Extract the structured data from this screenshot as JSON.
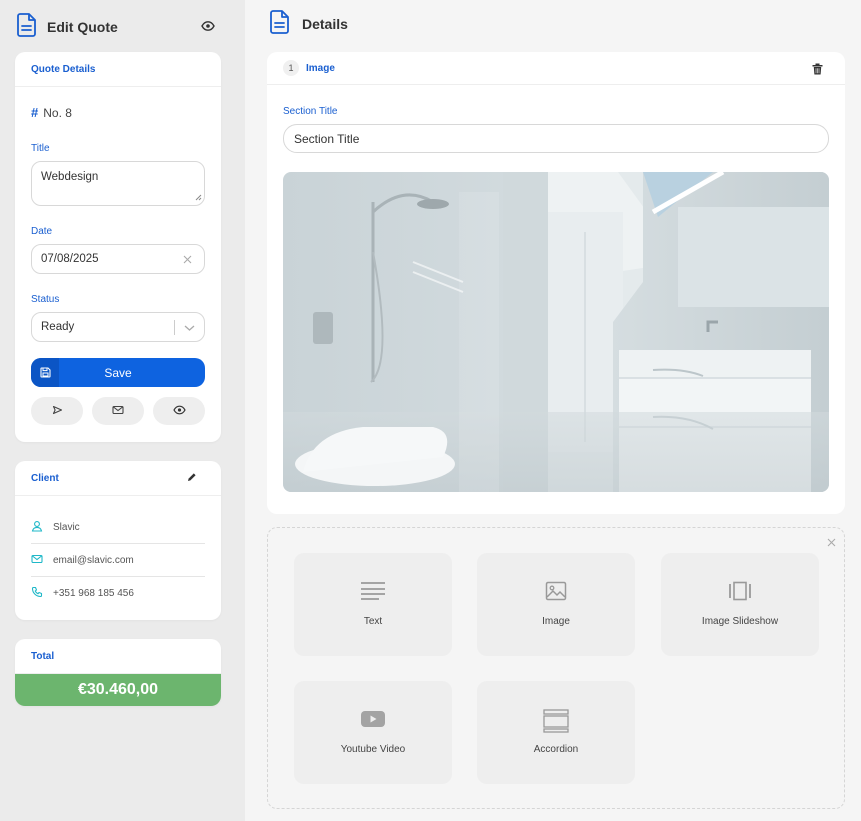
{
  "sidebar": {
    "title": "Edit Quote",
    "quote_details": {
      "heading": "Quote Details",
      "number": "No. 8",
      "title_label": "Title",
      "title_value": "Webdesign",
      "date_label": "Date",
      "date_value": "07/08/2025",
      "status_label": "Status",
      "status_value": "Ready",
      "save_label": "Save"
    },
    "client": {
      "heading": "Client",
      "name": "Slavic",
      "email": "email@slavic.com",
      "phone": "+351 968 185 456"
    },
    "total": {
      "heading": "Total",
      "value": "€30.460,00"
    }
  },
  "main": {
    "title": "Details",
    "section": {
      "number": "1",
      "type_label": "Image",
      "field_label": "Section Title",
      "field_value": "Section Title"
    },
    "blocks": [
      {
        "label": "Text",
        "icon": "text-lines-icon"
      },
      {
        "label": "Image",
        "icon": "image-icon"
      },
      {
        "label": "Image Slideshow",
        "icon": "slideshow-icon"
      },
      {
        "label": "Youtube Video",
        "icon": "video-play-icon"
      },
      {
        "label": "Accordion",
        "icon": "accordion-icon"
      }
    ]
  },
  "colors": {
    "accent": "#0e63e0",
    "label_blue": "#1a5fd0",
    "client_icons": "#1fb8c8",
    "total_green": "#6cb56e",
    "sidebar_bg": "#ebebeb"
  }
}
